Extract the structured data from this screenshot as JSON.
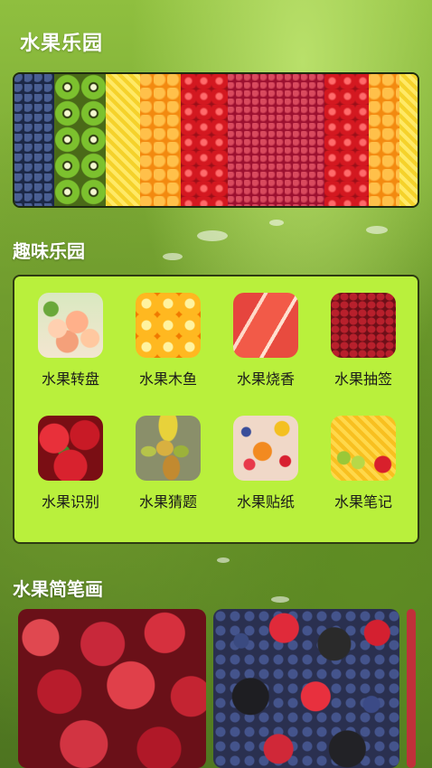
{
  "app": {
    "title": "水果乐园"
  },
  "banner": {
    "icon": "fruit-rainbow-banner-image"
  },
  "fun_section": {
    "title": "趣味乐园",
    "items": [
      {
        "label": "水果转盘",
        "icon": "peaches-image"
      },
      {
        "label": "水果木鱼",
        "icon": "orange-slices-image"
      },
      {
        "label": "水果烧香",
        "icon": "grapefruit-image"
      },
      {
        "label": "水果抽签",
        "icon": "red-dates-image"
      },
      {
        "label": "水果识别",
        "icon": "red-apples-image"
      },
      {
        "label": "水果猜题",
        "icon": "mangoes-image"
      },
      {
        "label": "水果贴纸",
        "icon": "fruit-salad-image"
      },
      {
        "label": "水果笔记",
        "icon": "mango-cubes-image"
      }
    ]
  },
  "drawing_section": {
    "title": "水果简笔画",
    "photos": [
      {
        "icon": "red-apples-photo"
      },
      {
        "icon": "mixed-berries-photo"
      }
    ]
  },
  "colors": {
    "card_background": "#b9f03c",
    "text_dark": "#1a1a1a",
    "title_text": "#ffffff"
  }
}
